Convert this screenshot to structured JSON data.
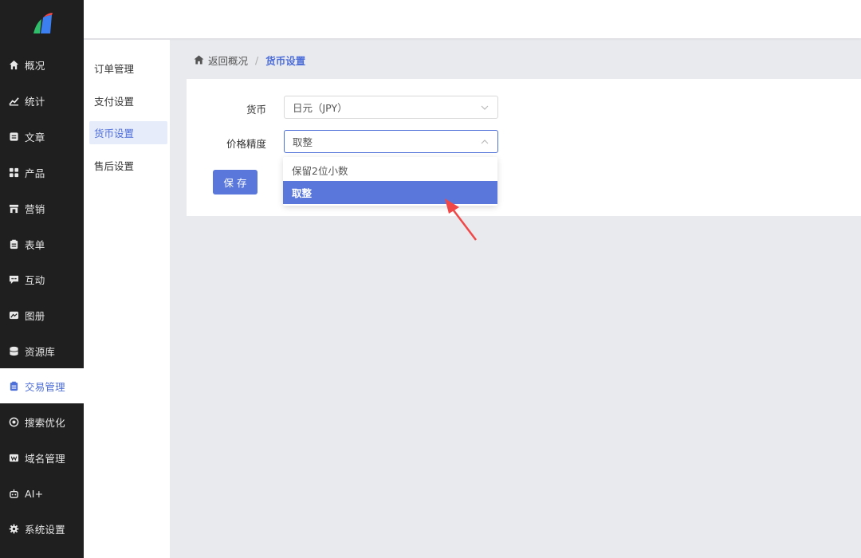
{
  "sidebar": {
    "items": [
      {
        "label": "概况",
        "icon": "home-icon"
      },
      {
        "label": "统计",
        "icon": "chart-icon"
      },
      {
        "label": "文章",
        "icon": "article-icon"
      },
      {
        "label": "产品",
        "icon": "grid-icon"
      },
      {
        "label": "营销",
        "icon": "store-icon"
      },
      {
        "label": "表单",
        "icon": "form-icon"
      },
      {
        "label": "互动",
        "icon": "chat-icon"
      },
      {
        "label": "图册",
        "icon": "image-icon"
      },
      {
        "label": "资源库",
        "icon": "database-icon"
      },
      {
        "label": "交易管理",
        "icon": "clipboard-icon"
      },
      {
        "label": "搜索优化",
        "icon": "target-icon"
      },
      {
        "label": "域名管理",
        "icon": "domain-icon"
      },
      {
        "label": "AI+",
        "icon": "robot-icon"
      },
      {
        "label": "系统设置",
        "icon": "gear-icon"
      }
    ],
    "active_index": 9
  },
  "submenu": {
    "items": [
      {
        "label": "订单管理"
      },
      {
        "label": "支付设置"
      },
      {
        "label": "货币设置"
      },
      {
        "label": "售后设置"
      }
    ],
    "active_index": 2
  },
  "breadcrumb": {
    "back": "返回概况",
    "separator": "/",
    "current": "货币设置"
  },
  "form": {
    "currency_label": "货币",
    "currency_value": "日元（JPY）",
    "precision_label": "价格精度",
    "precision_value": "取整",
    "save_label": "保存"
  },
  "dropdown": {
    "options": [
      {
        "label": "保留2位小数"
      },
      {
        "label": "取整"
      }
    ],
    "selected_index": 1
  },
  "colors": {
    "accent": "#5a78dc",
    "sidebar_bg": "#1f1f1f",
    "annotation_arrow": "#f04848"
  }
}
